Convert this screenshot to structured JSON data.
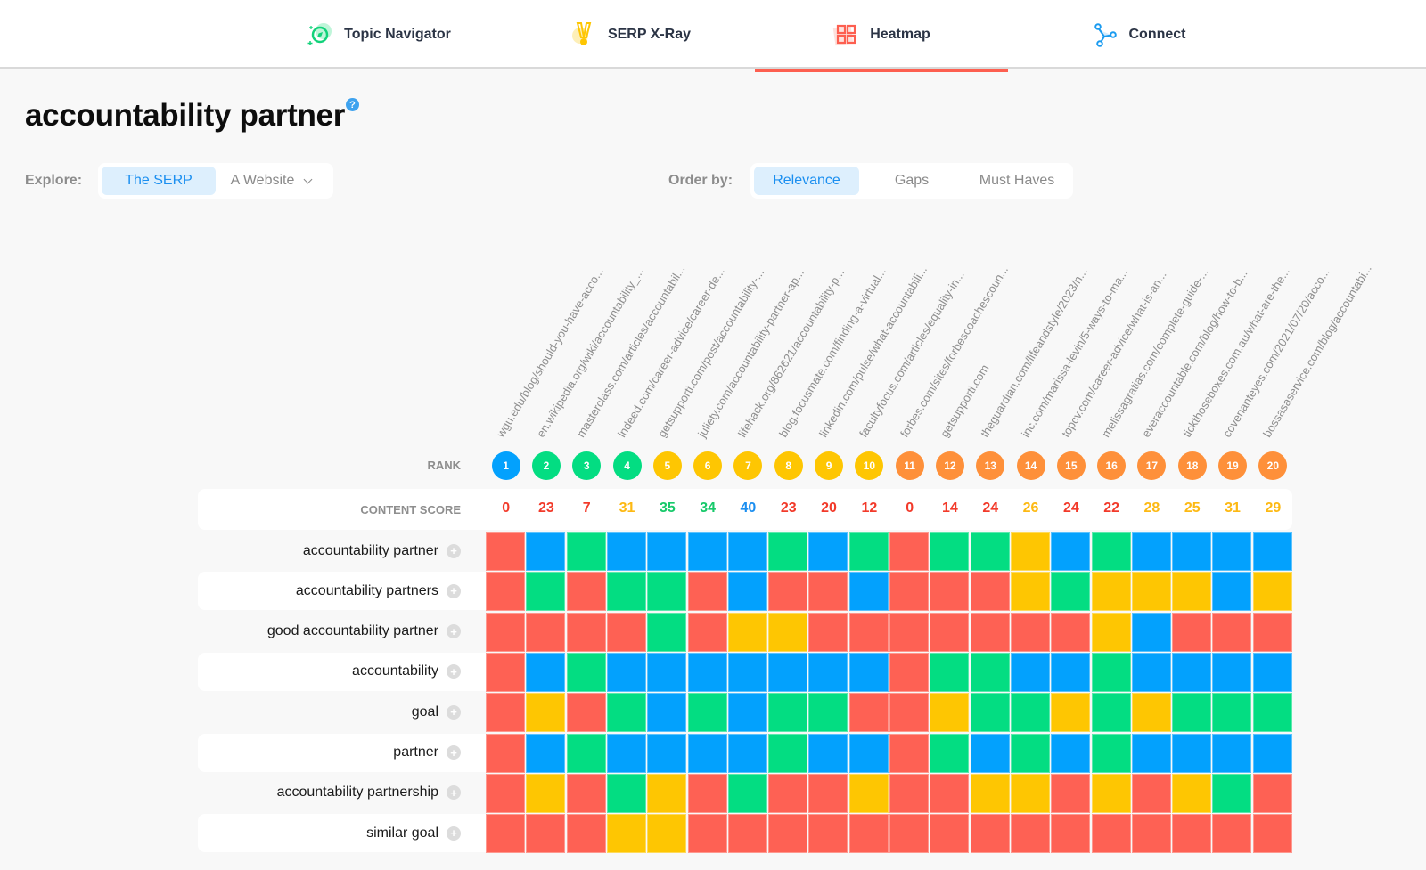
{
  "nav": {
    "tabs": [
      {
        "label": "Topic Navigator",
        "icon": "compass-icon",
        "active": false
      },
      {
        "label": "SERP X-Ray",
        "icon": "medal-icon",
        "active": false
      },
      {
        "label": "Heatmap",
        "icon": "grid-icon",
        "active": true
      },
      {
        "label": "Connect",
        "icon": "network-icon",
        "active": false
      }
    ]
  },
  "page": {
    "title": "accountability partner",
    "help_glyph": "?"
  },
  "explore": {
    "label": "Explore:",
    "options": [
      {
        "label": "The SERP",
        "active": true
      },
      {
        "label": "A Website",
        "active": false,
        "dropdown": true
      }
    ]
  },
  "order_by": {
    "label": "Order by:",
    "options": [
      {
        "label": "Relevance",
        "active": true
      },
      {
        "label": "Gaps",
        "active": false
      },
      {
        "label": "Must Haves",
        "active": false
      }
    ]
  },
  "colors": {
    "red": "#fe6154",
    "blue": "#03a1fd",
    "green": "#03dd82",
    "yellow": "#fec602",
    "orange": "#fe903a",
    "score_red": "#f23a2a",
    "score_yellow": "#fdb913",
    "score_green": "#17c96a",
    "score_blue": "#1a8ef0"
  },
  "table": {
    "rank_label": "RANK",
    "score_label": "CONTENT SCORE",
    "results": [
      {
        "rank": "1",
        "url": "wgu.edu/blog/should-you-have-acco...",
        "score": "0",
        "rank_color": "blue",
        "score_color": "score_red"
      },
      {
        "rank": "2",
        "url": "en.wikipedia.org/wiki/accountability_...",
        "score": "23",
        "rank_color": "green",
        "score_color": "score_red"
      },
      {
        "rank": "3",
        "url": "masterclass.com/articles/accountabil...",
        "score": "7",
        "rank_color": "green",
        "score_color": "score_red"
      },
      {
        "rank": "4",
        "url": "indeed.com/career-advice/career-de...",
        "score": "31",
        "rank_color": "green",
        "score_color": "score_yellow"
      },
      {
        "rank": "5",
        "url": "getsupporti.com/post/accountability-...",
        "score": "35",
        "rank_color": "yellow",
        "score_color": "score_green"
      },
      {
        "rank": "6",
        "url": "juliety.com/accountability-partner-ap...",
        "score": "34",
        "rank_color": "yellow",
        "score_color": "score_green"
      },
      {
        "rank": "7",
        "url": "lifehack.org/862621/accountability-p...",
        "score": "40",
        "rank_color": "yellow",
        "score_color": "score_blue"
      },
      {
        "rank": "8",
        "url": "blog.focusmate.com/finding-a-virtual...",
        "score": "23",
        "rank_color": "yellow",
        "score_color": "score_red"
      },
      {
        "rank": "9",
        "url": "linkedin.com/pulse/what-accountabili...",
        "score": "20",
        "rank_color": "yellow",
        "score_color": "score_red"
      },
      {
        "rank": "10",
        "url": "facultyfocus.com/articles/equality-in...",
        "score": "12",
        "rank_color": "yellow",
        "score_color": "score_red"
      },
      {
        "rank": "11",
        "url": "forbes.com/sites/forbescoachescoun...",
        "score": "0",
        "rank_color": "orange",
        "score_color": "score_red"
      },
      {
        "rank": "12",
        "url": "getsupporti.com",
        "score": "14",
        "rank_color": "orange",
        "score_color": "score_red"
      },
      {
        "rank": "13",
        "url": "theguardian.com/lifeandstyle/2023/n...",
        "score": "24",
        "rank_color": "orange",
        "score_color": "score_red"
      },
      {
        "rank": "14",
        "url": "inc.com/marissa-levin/5-ways-to-ma...",
        "score": "26",
        "rank_color": "orange",
        "score_color": "score_yellow"
      },
      {
        "rank": "15",
        "url": "topcv.com/career-advice/what-is-an...",
        "score": "24",
        "rank_color": "orange",
        "score_color": "score_red"
      },
      {
        "rank": "16",
        "url": "melissagratias.com/complete-guide-...",
        "score": "22",
        "rank_color": "orange",
        "score_color": "score_red"
      },
      {
        "rank": "17",
        "url": "everaccountable.com/blog/how-to-b...",
        "score": "28",
        "rank_color": "orange",
        "score_color": "score_yellow"
      },
      {
        "rank": "18",
        "url": "tickthoseboxes.com.au/what-are-the...",
        "score": "25",
        "rank_color": "orange",
        "score_color": "score_yellow"
      },
      {
        "rank": "19",
        "url": "covenanteyes.com/2021/07/20/acco...",
        "score": "31",
        "rank_color": "orange",
        "score_color": "score_yellow"
      },
      {
        "rank": "20",
        "url": "bossasaservice.com/blog/accountabi...",
        "score": "29",
        "rank_color": "orange",
        "score_color": "score_yellow"
      }
    ],
    "keywords": [
      {
        "label": "accountability partner",
        "cells": [
          "red",
          "blue",
          "green",
          "blue",
          "blue",
          "blue",
          "blue",
          "green",
          "blue",
          "green",
          "red",
          "green",
          "green",
          "yellow",
          "blue",
          "green",
          "blue",
          "blue",
          "blue",
          "blue"
        ]
      },
      {
        "label": "accountability partners",
        "cells": [
          "red",
          "green",
          "red",
          "green",
          "green",
          "red",
          "blue",
          "red",
          "red",
          "blue",
          "red",
          "red",
          "red",
          "yellow",
          "green",
          "yellow",
          "yellow",
          "yellow",
          "blue",
          "yellow"
        ]
      },
      {
        "label": "good accountability partner",
        "cells": [
          "red",
          "red",
          "red",
          "red",
          "green",
          "red",
          "yellow",
          "yellow",
          "red",
          "red",
          "red",
          "red",
          "red",
          "red",
          "red",
          "yellow",
          "blue",
          "red",
          "red",
          "red"
        ]
      },
      {
        "label": "accountability",
        "cells": [
          "red",
          "blue",
          "green",
          "blue",
          "blue",
          "blue",
          "blue",
          "blue",
          "blue",
          "blue",
          "red",
          "green",
          "green",
          "blue",
          "blue",
          "green",
          "blue",
          "blue",
          "blue",
          "blue"
        ]
      },
      {
        "label": "goal",
        "cells": [
          "red",
          "yellow",
          "red",
          "green",
          "blue",
          "green",
          "blue",
          "green",
          "green",
          "red",
          "red",
          "yellow",
          "green",
          "green",
          "yellow",
          "green",
          "yellow",
          "green",
          "green",
          "green"
        ]
      },
      {
        "label": "partner",
        "cells": [
          "red",
          "blue",
          "green",
          "blue",
          "blue",
          "blue",
          "blue",
          "green",
          "blue",
          "blue",
          "red",
          "green",
          "blue",
          "green",
          "blue",
          "green",
          "blue",
          "blue",
          "blue",
          "blue"
        ]
      },
      {
        "label": "accountability partnership",
        "cells": [
          "red",
          "yellow",
          "red",
          "green",
          "yellow",
          "red",
          "green",
          "red",
          "red",
          "yellow",
          "red",
          "red",
          "yellow",
          "yellow",
          "red",
          "yellow",
          "red",
          "yellow",
          "green",
          "red"
        ]
      },
      {
        "label": "similar goal",
        "cells": [
          "red",
          "red",
          "red",
          "yellow",
          "yellow",
          "red",
          "red",
          "red",
          "red",
          "red",
          "red",
          "red",
          "red",
          "red",
          "red",
          "red",
          "red",
          "red",
          "red",
          "red"
        ]
      }
    ],
    "expand_glyph": "+"
  }
}
